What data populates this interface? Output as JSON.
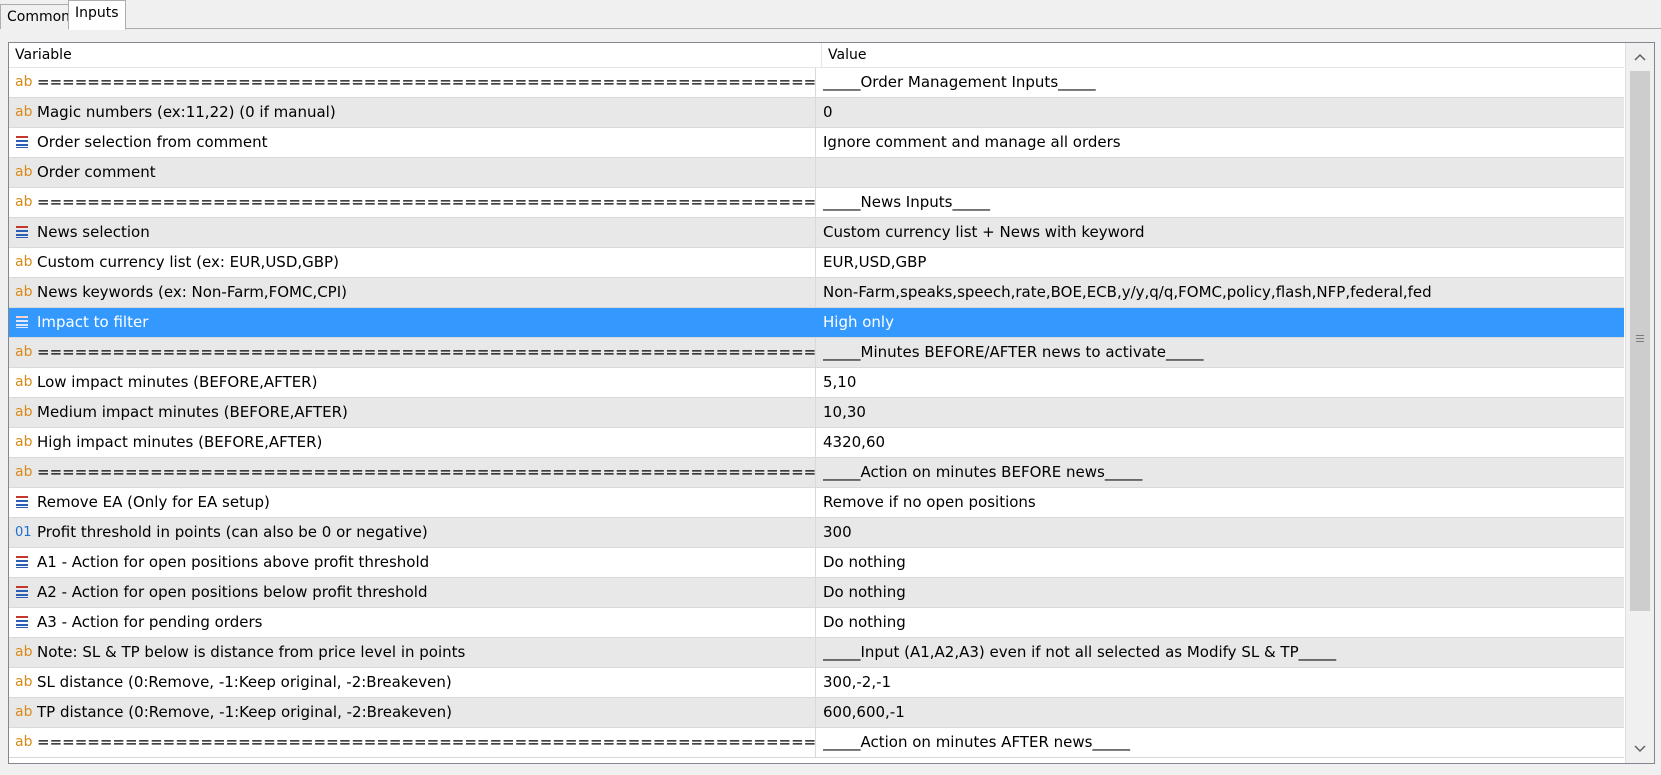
{
  "tabs": [
    {
      "label": "Common",
      "active": false
    },
    {
      "label": "Inputs",
      "active": true
    }
  ],
  "columns": {
    "variable": "Variable",
    "value": "Value"
  },
  "colors": {
    "selection": "#3399ff",
    "string_icon": "#d98b1a",
    "enum_icon": "#c0392b",
    "int_icon": "#1f6fd1"
  },
  "rows": [
    {
      "type": "string",
      "icon": "ab",
      "variable": "==============================================================",
      "value": "_____Order Management Inputs_____"
    },
    {
      "type": "string",
      "icon": "ab",
      "variable": "Magic numbers (ex:11,22) (0 if manual)",
      "value": "0"
    },
    {
      "type": "enum",
      "icon": "list-icon",
      "variable": "Order selection from comment",
      "value": "Ignore comment and manage all orders"
    },
    {
      "type": "string",
      "icon": "ab",
      "variable": "Order comment",
      "value": ""
    },
    {
      "type": "string",
      "icon": "ab",
      "variable": "==============================================================",
      "value": "_____News Inputs_____"
    },
    {
      "type": "enum",
      "icon": "list-icon",
      "variable": "News selection",
      "value": "Custom currency list + News with keyword"
    },
    {
      "type": "string",
      "icon": "ab",
      "variable": "Custom currency list (ex: EUR,USD,GBP)",
      "value": "EUR,USD,GBP"
    },
    {
      "type": "string",
      "icon": "ab",
      "variable": "News keywords (ex: Non-Farm,FOMC,CPI)",
      "value": "Non-Farm,speaks,speech,rate,BOE,ECB,y/y,q/q,FOMC,policy,flash,NFP,federal,fed"
    },
    {
      "type": "enum",
      "icon": "list-icon",
      "variable": "Impact to filter",
      "value": "High only",
      "selected": true
    },
    {
      "type": "string",
      "icon": "ab",
      "variable": "==============================================================",
      "value": "_____Minutes BEFORE/AFTER news to activate_____"
    },
    {
      "type": "string",
      "icon": "ab",
      "variable": "Low impact minutes (BEFORE,AFTER)",
      "value": "5,10"
    },
    {
      "type": "string",
      "icon": "ab",
      "variable": "Medium impact minutes (BEFORE,AFTER)",
      "value": "10,30"
    },
    {
      "type": "string",
      "icon": "ab",
      "variable": "High impact minutes (BEFORE,AFTER)",
      "value": "4320,60"
    },
    {
      "type": "string",
      "icon": "ab",
      "variable": "==============================================================",
      "value": "_____Action on minutes BEFORE news_____"
    },
    {
      "type": "enum",
      "icon": "list-icon",
      "variable": "Remove EA (Only for EA setup)",
      "value": "Remove if no open positions"
    },
    {
      "type": "int",
      "icon": "01",
      "variable": "Profit threshold in points (can also be 0 or negative)",
      "value": "300"
    },
    {
      "type": "enum",
      "icon": "list-icon",
      "variable": "A1 - Action for open positions above profit threshold",
      "value": "Do nothing"
    },
    {
      "type": "enum",
      "icon": "list-icon",
      "variable": "A2 - Action for open positions below profit threshold",
      "value": "Do nothing"
    },
    {
      "type": "enum",
      "icon": "list-icon",
      "variable": "A3 - Action for pending orders",
      "value": "Do nothing"
    },
    {
      "type": "string",
      "icon": "ab",
      "variable": "Note: SL & TP below is distance from price level in points",
      "value": "_____Input (A1,A2,A3) even if not all selected as Modify SL & TP_____"
    },
    {
      "type": "string",
      "icon": "ab",
      "variable": "SL distance (0:Remove, -1:Keep original, -2:Breakeven)",
      "value": "300,-2,-1"
    },
    {
      "type": "string",
      "icon": "ab",
      "variable": "TP distance (0:Remove, -1:Keep original, -2:Breakeven)",
      "value": "600,600,-1"
    },
    {
      "type": "string",
      "icon": "ab",
      "variable": "==============================================================",
      "value": "_____Action on minutes AFTER news_____"
    }
  ],
  "scrollbar": {
    "up_glyph": "⌃",
    "down_glyph": "⌄"
  }
}
